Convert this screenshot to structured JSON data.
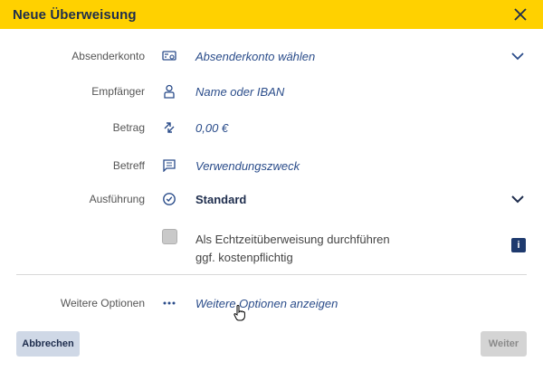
{
  "dialog": {
    "title": "Neue Überweisung",
    "close_icon": "close-icon"
  },
  "form": {
    "sender": {
      "label": "Absenderkonto",
      "placeholder": "Absenderkonto wählen",
      "icon": "account-card-icon"
    },
    "recipient": {
      "label": "Empfänger",
      "placeholder": "Name oder IBAN",
      "icon": "person-icon"
    },
    "amount": {
      "label": "Betrag",
      "value": "0,00 €",
      "icon": "transfer-arrows-icon"
    },
    "subject": {
      "label": "Betreff",
      "placeholder": "Verwendungszweck",
      "icon": "message-icon"
    },
    "execution": {
      "label": "Ausführung",
      "value": "Standard",
      "icon": "clock-icon"
    },
    "instant": {
      "line1": "Als Echtzeitüberweisung durchführen",
      "line2": "ggf. kostenpflichtig",
      "checked": false,
      "info_label": "i"
    },
    "more": {
      "label": "Weitere Optionen",
      "link": "Weitere Optionen anzeigen",
      "icon": "more-dots-icon"
    }
  },
  "buttons": {
    "cancel": "Abbrechen",
    "next": "Weiter"
  },
  "colors": {
    "header": "#ffd100",
    "accent": "#2a4c8a",
    "dark": "#1e2d4d"
  }
}
